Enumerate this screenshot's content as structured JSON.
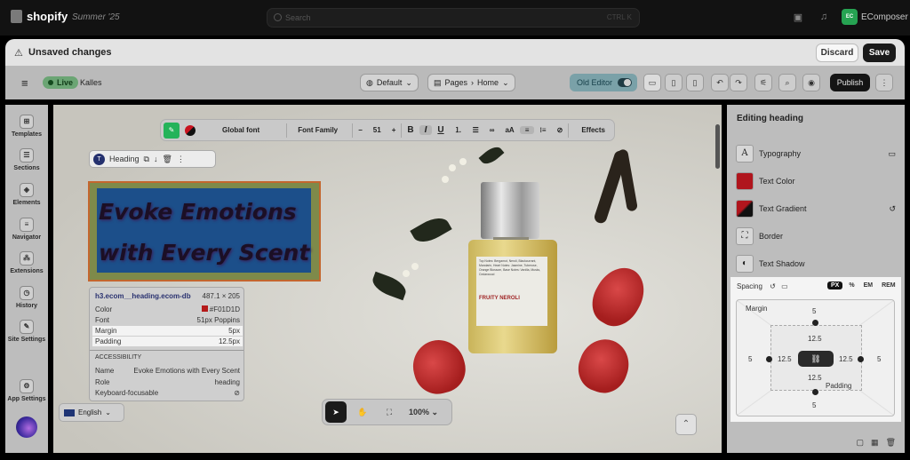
{
  "topbar": {
    "brand": "shopify",
    "edition": "Summer '25",
    "search_placeholder": "Search",
    "search_shortcut": "CTRL  K",
    "app_badge": "EC",
    "app_name": "EComposer"
  },
  "unsaved": {
    "title": "Unsaved changes",
    "discard": "Discard",
    "save": "Save"
  },
  "editorbar": {
    "status": "Live",
    "theme": "Kalles",
    "device_preset": "Default",
    "breadcrumb_pages": "Pages",
    "breadcrumb_home": "Home",
    "old_editor": "Old Editor",
    "publish": "Publish"
  },
  "sidebar": {
    "items": [
      {
        "label": "Templates",
        "icon": "templates-icon"
      },
      {
        "label": "Sections",
        "icon": "sections-icon"
      },
      {
        "label": "Elements",
        "icon": "elements-icon"
      },
      {
        "label": "Navigator",
        "icon": "navigator-icon"
      },
      {
        "label": "Extensions",
        "icon": "extensions-icon"
      },
      {
        "label": "History",
        "icon": "history-icon"
      },
      {
        "label": "Site Settings",
        "icon": "site-settings-icon"
      },
      {
        "label": "App Settings",
        "icon": "app-settings-icon"
      }
    ]
  },
  "format_toolbar": {
    "global_font": "Global font",
    "font_family": "Font Family",
    "font_size": "51",
    "effects": "Effects"
  },
  "selection": {
    "label": "Heading"
  },
  "heading": {
    "line1": "Evoke Emotions",
    "line2": "with Every Scent"
  },
  "tooltip": {
    "selector": "h3.ecom__heading.ecom-db",
    "dimensions": "487.1 × 205",
    "color_label": "Color",
    "color_value": "#F01D1D",
    "font_label": "Font",
    "font_value": "51px Poppins",
    "margin_label": "Margin",
    "margin_value": "5px",
    "padding_label": "Padding",
    "padding_value": "12.5px",
    "accessibility": "ACCESSIBILITY",
    "name_label": "Name",
    "name_value": "Evoke Emotions  with Every Scent",
    "role_label": "Role",
    "role_value": "heading",
    "keyboard_label": "Keyboard-focusable"
  },
  "product": {
    "label_text": "Top Notes: Bergamot, Neroli, Blackcurrant, Mandarin, Heart Notes: Jasmine, Tuberose, Orange Blossom, Base Notes: Vanilla, Musks, Cedarwood",
    "label_name": "FRUITY NEROLI"
  },
  "language": "English",
  "zoom": "100%",
  "right_panel": {
    "title": "Editing heading",
    "rows": [
      {
        "label": "Typography",
        "icon": "typography-icon"
      },
      {
        "label": "Text Color",
        "icon": "text-color-swatch"
      },
      {
        "label": "Text Gradient",
        "icon": "text-gradient-swatch"
      },
      {
        "label": "Border",
        "icon": "border-icon"
      },
      {
        "label": "Text Shadow",
        "icon": "text-shadow-icon"
      }
    ],
    "spacing": {
      "label": "Spacing",
      "units": [
        "PX",
        "%",
        "EM",
        "REM"
      ],
      "margin_label": "Margin",
      "padding_label": "Padding",
      "margin_top": "5",
      "margin_right": "5",
      "margin_bottom": "5",
      "margin_left": "5",
      "padding_top": "12.5",
      "padding_right": "12.5",
      "padding_bottom": "12.5",
      "padding_left": "12.5"
    }
  },
  "colors": {
    "live_green": "#6ba574",
    "text_color": "#F01D1D",
    "app_green": "#26a352"
  }
}
